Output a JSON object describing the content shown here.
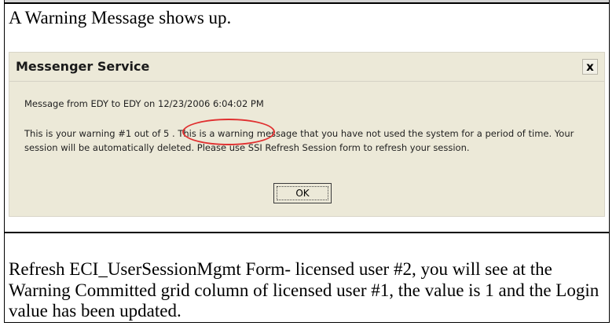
{
  "intro": {
    "text": "A Warning Message shows up."
  },
  "dialog": {
    "title": "Messenger Service",
    "close_label": "x",
    "header_line": "Message from EDY to EDY on 12/23/2006 6:04:02 PM",
    "body_part1": "This is your warning ",
    "body_highlight": "#1 out of 5",
    "body_part2": " . This is a warning message that you have not used the system for a period of time. Your session will be automatically deleted. Please use SSI Refresh Session form to refresh your session.",
    "ok_label": "OK",
    "colors": {
      "background": "#ece9d8",
      "annotation": "#e03030"
    }
  },
  "instructions": {
    "text": "Refresh ECI_UserSessionMgmt Form- licensed user #2, you will see at the Warning Committed grid column of licensed user #1, the value is 1 and the Login value has been updated."
  }
}
